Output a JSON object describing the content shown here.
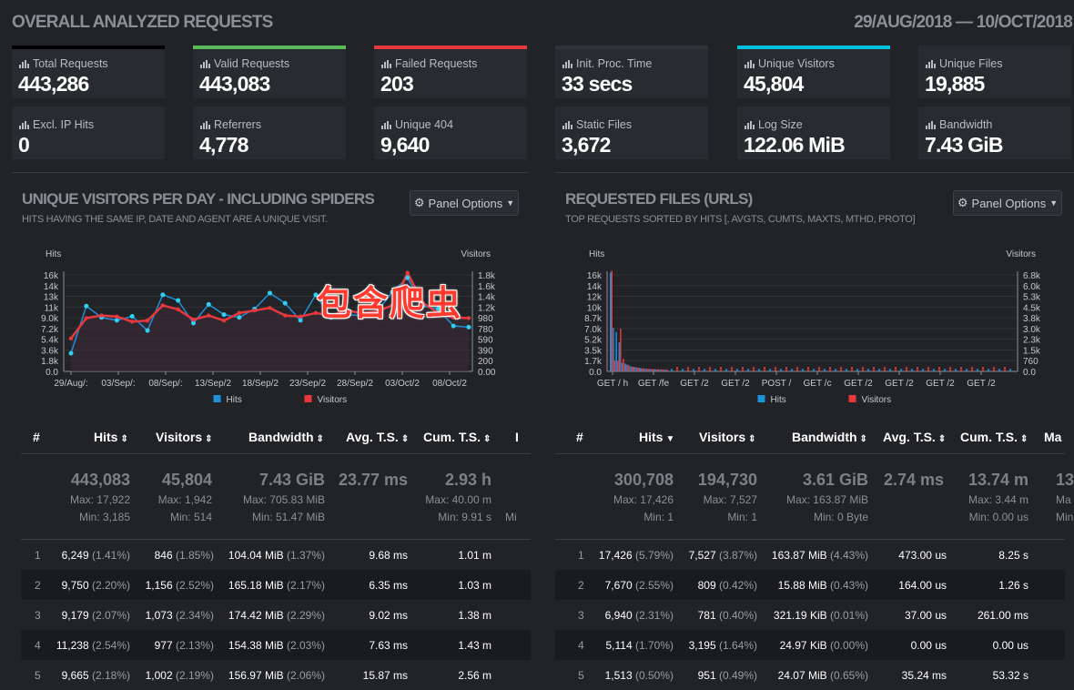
{
  "header": {
    "title": "OVERALL ANALYZED REQUESTS",
    "date_range": "29/AUG/2018 — 10/OCT/2018"
  },
  "cards": [
    {
      "label": "Total Requests",
      "value": "443,286",
      "accent": "#000000"
    },
    {
      "label": "Valid Requests",
      "value": "443,083",
      "accent": "#5cb85c"
    },
    {
      "label": "Failed Requests",
      "value": "203",
      "accent": "#e8383d"
    },
    {
      "label": "Init. Proc. Time",
      "value": "33 secs",
      "accent": "#2e3338"
    },
    {
      "label": "Unique Visitors",
      "value": "45,804",
      "accent": "#00c0e0"
    },
    {
      "label": "Unique Files",
      "value": "19,885",
      "accent": "#282b2f"
    },
    {
      "label": "Excl. IP Hits",
      "value": "0",
      "accent": "#282b2f"
    },
    {
      "label": "Referrers",
      "value": "4,778",
      "accent": "#282b2f"
    },
    {
      "label": "Unique 404",
      "value": "9,640",
      "accent": "#282b2f"
    },
    {
      "label": "Static Files",
      "value": "3,672",
      "accent": "#282b2f"
    },
    {
      "label": "Log Size",
      "value": "122.06 MiB",
      "accent": "#282b2f"
    },
    {
      "label": "Bandwidth",
      "value": "7.43 GiB",
      "accent": "#282b2f"
    }
  ],
  "left_panel": {
    "title": "UNIQUE VISITORS PER DAY - INCLUDING SPIDERS",
    "subtitle": "HITS HAVING THE SAME IP, DATE AND AGENT ARE A UNIQUE VISIT.",
    "options_label": "Panel Options",
    "stamp": "包含爬虫",
    "columns": [
      "#",
      "Hits",
      "Visitors",
      "Bandwidth",
      "Avg. T.S.",
      "Cum. T.S.",
      "I"
    ],
    "summary": {
      "hits": {
        "total": "443,083",
        "max": "Max: 17,922",
        "min": "Min: 3,185"
      },
      "visitors": {
        "total": "45,804",
        "max": "Max: 1,942",
        "min": "Min: 514"
      },
      "bandwidth": {
        "total": "7.43 GiB",
        "max": "Max: 705.83 MiB",
        "min": "Min: 51.47 MiB"
      },
      "avg_ts": {
        "total": "23.77 ms"
      },
      "cum_ts": {
        "total": "2.93 h",
        "max": "Max: 40.00 m",
        "min": "Min: 9.91 s"
      },
      "extra_min": "Mi"
    },
    "rows": [
      {
        "idx": "1",
        "hits": "6,249",
        "hits_pct": "(1.41%)",
        "visitors": "846",
        "visitors_pct": "(1.85%)",
        "bw": "104.04 MiB",
        "bw_pct": "(1.37%)",
        "avg": "9.68 ms",
        "cum": "1.01 m"
      },
      {
        "idx": "2",
        "hits": "9,750",
        "hits_pct": "(2.20%)",
        "visitors": "1,156",
        "visitors_pct": "(2.52%)",
        "bw": "165.18 MiB",
        "bw_pct": "(2.17%)",
        "avg": "6.35 ms",
        "cum": "1.03 m"
      },
      {
        "idx": "3",
        "hits": "9,179",
        "hits_pct": "(2.07%)",
        "visitors": "1,073",
        "visitors_pct": "(2.34%)",
        "bw": "174.42 MiB",
        "bw_pct": "(2.29%)",
        "avg": "9.02 ms",
        "cum": "1.38 m"
      },
      {
        "idx": "4",
        "hits": "11,238",
        "hits_pct": "(2.54%)",
        "visitors": "977",
        "visitors_pct": "(2.13%)",
        "bw": "154.38 MiB",
        "bw_pct": "(2.03%)",
        "avg": "7.63 ms",
        "cum": "1.43 m"
      },
      {
        "idx": "5",
        "hits": "9,665",
        "hits_pct": "(2.18%)",
        "visitors": "1,002",
        "visitors_pct": "(2.19%)",
        "bw": "156.97 MiB",
        "bw_pct": "(2.06%)",
        "avg": "15.87 ms",
        "cum": "2.56 m"
      }
    ]
  },
  "right_panel": {
    "title": "REQUESTED FILES (URLS)",
    "subtitle": "TOP REQUESTS SORTED BY HITS [, AVGTS, CUMTS, MAXTS, MTHD, PROTO]",
    "options_label": "Panel Options",
    "columns": [
      "#",
      "Hits",
      "Visitors",
      "Bandwidth",
      "Avg. T.S.",
      "Cum. T.S.",
      "Ma"
    ],
    "summary": {
      "hits": {
        "total": "300,708",
        "max": "Max: 17,426",
        "min": "Min: 1"
      },
      "visitors": {
        "total": "194,730",
        "max": "Max: 7,527",
        "min": "Min: 1"
      },
      "bandwidth": {
        "total": "3.61 GiB",
        "max": "Max: 163.87 MiB",
        "min": "Min: 0 Byte"
      },
      "avg_ts": {
        "total": "2.74 ms"
      },
      "cum_ts": {
        "total": "13.74 m",
        "max": "Max: 3.44 m",
        "min": "Min: 0.00 us"
      },
      "extra_total": "13",
      "extra_max": "Ma",
      "extra_min": "Min"
    },
    "rows": [
      {
        "idx": "1",
        "hits": "17,426",
        "hits_pct": "(5.79%)",
        "visitors": "7,527",
        "visitors_pct": "(3.87%)",
        "bw": "163.87 MiB",
        "bw_pct": "(4.43%)",
        "avg": "473.00 us",
        "cum": "8.25 s"
      },
      {
        "idx": "2",
        "hits": "7,670",
        "hits_pct": "(2.55%)",
        "visitors": "809",
        "visitors_pct": "(0.42%)",
        "bw": "15.88 MiB",
        "bw_pct": "(0.43%)",
        "avg": "164.00 us",
        "cum": "1.26 s"
      },
      {
        "idx": "3",
        "hits": "6,940",
        "hits_pct": "(2.31%)",
        "visitors": "781",
        "visitors_pct": "(0.40%)",
        "bw": "321.19 KiB",
        "bw_pct": "(0.01%)",
        "avg": "37.00 us",
        "cum": "261.00 ms"
      },
      {
        "idx": "4",
        "hits": "5,114",
        "hits_pct": "(1.70%)",
        "visitors": "3,195",
        "visitors_pct": "(1.64%)",
        "bw": "24.97 KiB",
        "bw_pct": "(0.00%)",
        "avg": "0.00 us",
        "cum": "0.00 us"
      },
      {
        "idx": "5",
        "hits": "1,513",
        "hits_pct": "(0.50%)",
        "visitors": "951",
        "visitors_pct": "(0.49%)",
        "bw": "24.07 MiB",
        "bw_pct": "(0.65%)",
        "avg": "35.24 ms",
        "cum": "53.32 s"
      }
    ]
  },
  "chart_data": [
    {
      "type": "line",
      "ylabel": "Hits",
      "y2label": "Visitors",
      "yticks": [
        "0.0",
        "1.8k",
        "3.6k",
        "5.4k",
        "7.2k",
        "9.0k",
        "11k",
        "13k",
        "14k",
        "16k"
      ],
      "y2ticks": [
        "0.00",
        "200",
        "390",
        "590",
        "780",
        "980",
        "1.2k",
        "1.4k",
        "1.6k",
        "1.8k"
      ],
      "xticks": [
        "29/Aug/:",
        "03/Sep/:",
        "08/Sep/:",
        "13/Sep/2",
        "18/Sep/2",
        "23/Sep/2",
        "28/Sep/2",
        "03/Oct/2",
        "08/Oct/2"
      ],
      "ylim": [
        0,
        17000
      ],
      "y2lim": [
        0,
        1900
      ],
      "legend": [
        "Hits",
        "Visitors"
      ],
      "colors": {
        "hits": "#1e90d8",
        "visitors": "#e8383d"
      },
      "series": [
        {
          "name": "Hits",
          "values": [
            3185,
            11500,
            9500,
            9000,
            9700,
            7200,
            13500,
            12500,
            8500,
            11800,
            10000,
            9500,
            11000,
            13800,
            12000,
            9000,
            13500,
            9500,
            10000,
            9800,
            10500,
            14000,
            16500,
            11500,
            11000,
            8000,
            7800
          ]
        },
        {
          "name": "Visitors",
          "values": [
            650,
            1050,
            1100,
            1080,
            980,
            1000,
            1300,
            1220,
            1020,
            1100,
            1000,
            1150,
            1200,
            1250,
            1100,
            1080,
            1150,
            1100,
            1200,
            1150,
            1180,
            1300,
            1942,
            1350,
            1150,
            1060,
            1050
          ]
        }
      ]
    },
    {
      "type": "bar",
      "ylabel": "Hits",
      "y2label": "Visitors",
      "yticks": [
        "0.0",
        "1.7k",
        "3.5k",
        "5.2k",
        "7.0k",
        "8.7k",
        "10k",
        "12k",
        "14k",
        "16k"
      ],
      "y2ticks": [
        "0.0",
        "760",
        "1.5k",
        "2.3k",
        "3.0k",
        "3.8k",
        "4.5k",
        "5.3k",
        "6.0k",
        "6.8k"
      ],
      "xticks": [
        "GET / h",
        "GET /fe",
        "GET /2",
        "GET /2",
        "POST /",
        "GET /c",
        "GET /2",
        "GET /2",
        "GET /2",
        "GET /2"
      ],
      "ylim": [
        0,
        17000
      ],
      "y2lim": [
        0,
        7200
      ],
      "legend": [
        "Hits",
        "Visitors"
      ],
      "colors": {
        "hits": "#1e90d8",
        "visitors": "#e8383d"
      }
    }
  ]
}
